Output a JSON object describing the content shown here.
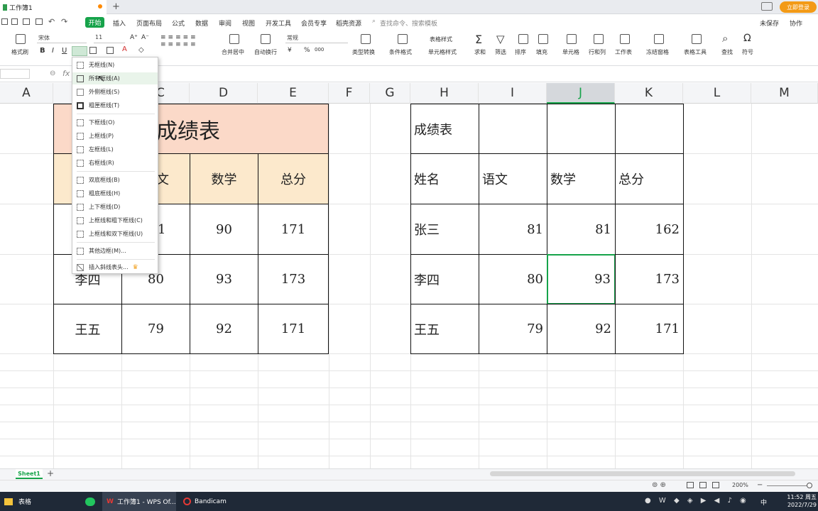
{
  "window": {
    "doc_tab": "工作簿1",
    "save_status": "未保存",
    "collab": "协作",
    "login": "立即登录"
  },
  "menu": {
    "items": [
      "开始",
      "插入",
      "页面布局",
      "公式",
      "数据",
      "审阅",
      "视图",
      "开发工具",
      "会员专享",
      "稻壳资源"
    ],
    "search_placeholder": "查找命令、搜索模板"
  },
  "ribbon": {
    "font_name": "宋体",
    "font_size": "11",
    "number_format": "常规",
    "labels": [
      "格式刷",
      "合并居中",
      "自动换行",
      "类型转换",
      "条件格式",
      "表格样式",
      "单元格样式",
      "求和",
      "筛选",
      "排序",
      "填充",
      "单元格",
      "行和列",
      "工作表",
      "冻结窗格",
      "表格工具",
      "查找",
      "符号"
    ],
    "bold": "B",
    "italic": "I",
    "underline": "U",
    "percent": "%",
    "currency": "¥",
    "thousands": "000"
  },
  "formula_bar": {
    "fx": "fx"
  },
  "columns": [
    "A",
    "C",
    "D",
    "E",
    "F",
    "G",
    "H",
    "I",
    "J",
    "K",
    "L",
    "M"
  ],
  "selected_column": "J",
  "left_table": {
    "title": "成绩表",
    "headers": [
      "文",
      "数学",
      "总分"
    ],
    "rows": [
      [
        "",
        "1",
        "90",
        "171"
      ],
      [
        "李四",
        "80",
        "93",
        "173"
      ],
      [
        "王五",
        "79",
        "92",
        "171"
      ]
    ]
  },
  "right_table": {
    "title": "成绩表",
    "headers": [
      "姓名",
      "语文",
      "数学",
      "总分"
    ],
    "rows": [
      [
        "张三",
        "81",
        "81",
        "162"
      ],
      [
        "李四",
        "80",
        "93",
        "173"
      ],
      [
        "王五",
        "79",
        "92",
        "171"
      ]
    ]
  },
  "border_menu": {
    "items": [
      "无框线(N)",
      "所有框线(A)",
      "外侧框线(S)",
      "粗匣框线(T)",
      "下框线(O)",
      "上框线(P)",
      "左框线(L)",
      "右框线(R)",
      "双底框线(B)",
      "粗底框线(H)",
      "上下框线(D)",
      "上框线和粗下框线(C)",
      "上框线和双下框线(U)",
      "其他边框(M)...",
      "插入斜线表头..."
    ],
    "highlighted_index": 1
  },
  "sheets": {
    "active": "Sheet1",
    "add": "+"
  },
  "status": {
    "zoom": "200%"
  },
  "taskbar": {
    "items": [
      "表格",
      "工作簿1 - WPS Of...",
      "Bandicam"
    ],
    "time": "11:52 周五",
    "date": "2022/7/29",
    "ime": "中"
  }
}
